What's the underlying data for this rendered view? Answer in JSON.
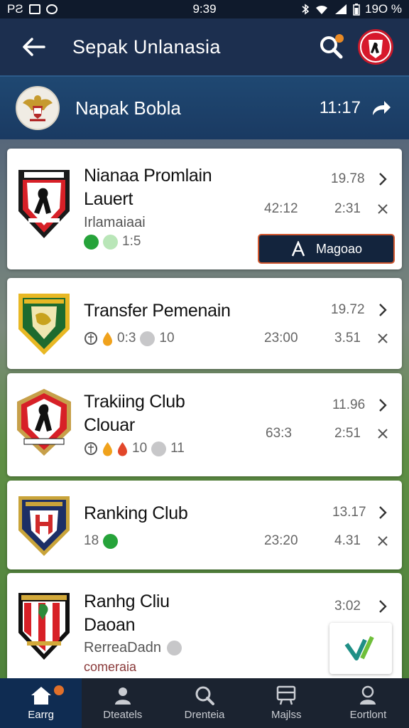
{
  "status_bar": {
    "left_text": "PƧ",
    "time": "9:39",
    "battery": "19O %"
  },
  "app_bar": {
    "title": "Sepak Unlanasia",
    "icons": [
      "back-arrow-icon",
      "search-icon",
      "profile-avatar"
    ],
    "accent": "#1c2f4f",
    "notification_color": "#e98a25"
  },
  "section_header": {
    "title": "Napak Bobla",
    "time": "11:17",
    "icon": "share-arrow-icon"
  },
  "cards": [
    {
      "title_line1": "Nianaa Promlain",
      "title_line2": "Lauert",
      "subtitle": "Irlamaiaai",
      "meta": "1:5",
      "time": "42:12",
      "value_top": "19.78",
      "value_bottom": "2:31",
      "button_label": "Magoao",
      "logo": "red-club-crest-icon"
    },
    {
      "title_line1": "Transfer Pemenain",
      "meta_a": "0:3",
      "meta_b": "10",
      "time": "23:00",
      "value_top": "19.72",
      "value_bottom": "3.51",
      "logo": "green-club-crest-icon"
    },
    {
      "title_line1": "Trakiing Club",
      "title_line2": "Clouar",
      "meta_a": "10",
      "meta_b": "11",
      "time": "63:3",
      "value_top": "11.96",
      "value_bottom": "2:51",
      "logo": "red-club-crest-icon"
    },
    {
      "title_line1": "Ranking Club",
      "meta_a": "18",
      "time": "23:20",
      "value_top": "13.17",
      "value_bottom": "4.31",
      "logo": "navy-club-crest-icon"
    },
    {
      "title_line1": "Ranhg Cliu",
      "title_line2": "Daoan",
      "subtitle": "RerreaDadn",
      "subtitle2": "comeraia",
      "value_top": "3:02",
      "logo": "striped-club-crest-icon"
    }
  ],
  "bottom_nav": {
    "items": [
      {
        "label": "Earrg",
        "icon": "home-icon",
        "active": true
      },
      {
        "label": "Dteatels",
        "icon": "person-icon",
        "active": false
      },
      {
        "label": "Drenteia",
        "icon": "search-icon",
        "active": false
      },
      {
        "label": "Majlss",
        "icon": "board-icon",
        "active": false
      },
      {
        "label": "Eortlont",
        "icon": "profile-icon",
        "active": false
      }
    ]
  }
}
